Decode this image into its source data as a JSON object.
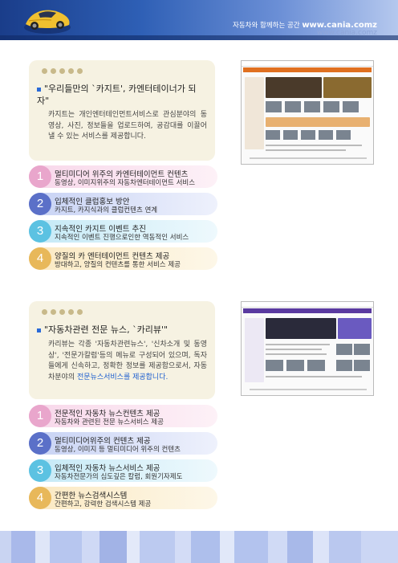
{
  "header": {
    "tagline_prefix": "자동차와 함께하는 공간",
    "tagline_url": "www.cania.comz",
    "ghost_url": "www.cania.comz",
    "logo_icon": "sports-car-icon"
  },
  "sections": [
    {
      "title": "\"우리들만의 `카지트', 카엔터테이너가 되자\"",
      "body": "카지트는 개인엔터테인먼트서비스로 관심분야의 동영상, 사진, 정보들을 업로드하여, 공감대를 이끌어 낼 수 있는 서비스를 제공합니다.",
      "body_highlight": "",
      "items": [
        {
          "num": "1",
          "title": "멀티미디어 위주의 카엔터테이먼트 컨텐츠",
          "desc": "동영상, 이미지위주의 자동차엔터테이먼트 서비스"
        },
        {
          "num": "2",
          "title": "입체적인 클럽홍보 방안",
          "desc": "카지트, 카지식과의 클럽컨텐츠 연계"
        },
        {
          "num": "3",
          "title": "지속적인 카지트 이벤트 추진",
          "desc": "지속적인 이벤트 진행으로인한 역동적인 서비스"
        },
        {
          "num": "4",
          "title": "양질의 카 엔터테이먼트 컨텐츠 제공",
          "desc": "방대하고, 양질의 컨텐츠를 통한 서비스 제공"
        }
      ]
    },
    {
      "title": "\"자동차관련 전문 뉴스, `카리뷰'\"",
      "body": "카리뷰는 각종 '자동차관련뉴스', '신차소개 및 동영상', '전문가칼럼'등의 메뉴로 구성되어 있으며, 독자들에게 신속하고, 정확한 정보를 제공함으로서, 자동차분야의 ",
      "body_highlight": "전문뉴스서비스를 제공합니다.",
      "items": [
        {
          "num": "1",
          "title": "전문적인 자동차 뉴스컨텐츠 제공",
          "desc": "자동차와 관련된 전문 뉴스서비스 제공"
        },
        {
          "num": "2",
          "title": "멀티미디어위주의 컨텐츠 제공",
          "desc": "동영상, 이미지 등 멀티미디어 위주의 컨텐츠"
        },
        {
          "num": "3",
          "title": "입체적인 자동차 뉴스서비스 제공",
          "desc": "자동차전문가의 심도깊은 칼럼, 회원기자제도"
        },
        {
          "num": "4",
          "title": "간편한 뉴스검색시스템",
          "desc": "간편하고, 강력한 검색시스템 제공"
        }
      ]
    }
  ],
  "colors": {
    "header_blue": "#1a3d8a",
    "card_bg": "#f6f2e2",
    "item1": "#e9a6cc",
    "item2": "#5b70c8",
    "item3": "#5cc2e2",
    "item4": "#e8b85a",
    "highlight": "#1e5fcf"
  }
}
